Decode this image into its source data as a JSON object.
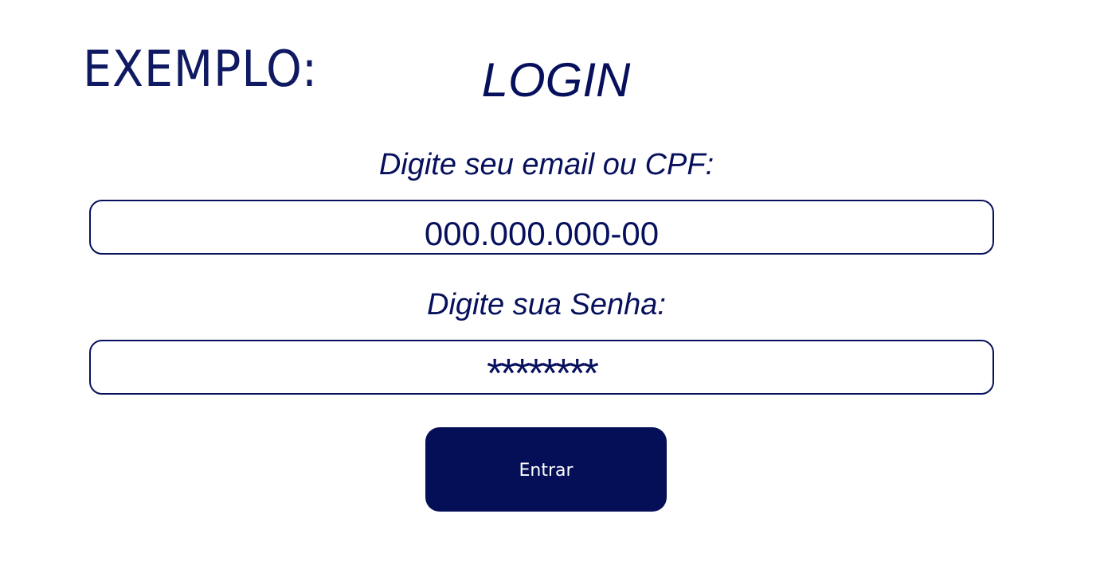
{
  "header": {
    "example_label": "EXEMPLO:",
    "title": "LOGIN"
  },
  "form": {
    "email_label": "Digite seu email ou CPF:",
    "email_value": "000.000.000-00",
    "password_label": "Digite sua Senha:",
    "password_value": "********",
    "submit_label": "Entrar"
  },
  "colors": {
    "primary": "#06105c",
    "button_background": "#050f58",
    "button_text": "#ffffff",
    "page_background": "#ffffff"
  }
}
